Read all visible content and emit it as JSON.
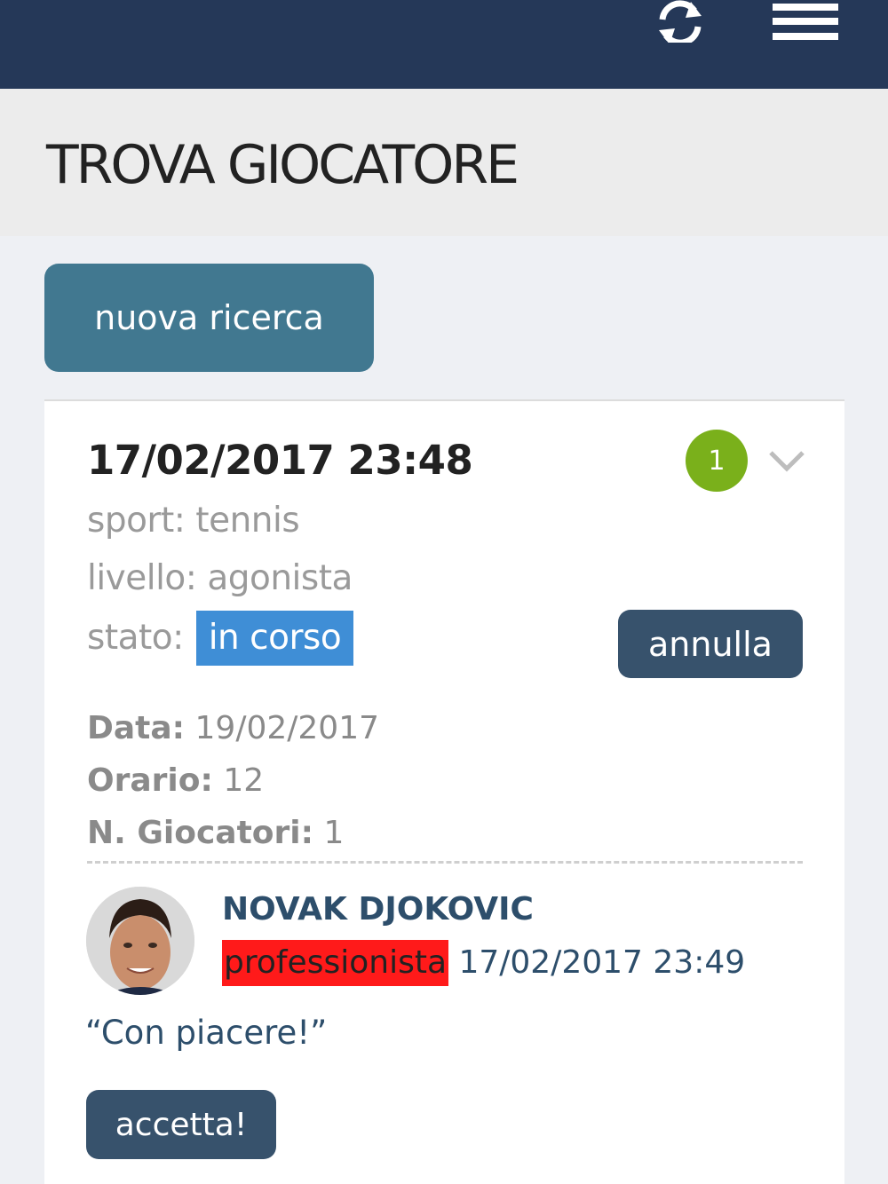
{
  "header": {
    "refresh_icon": "refresh-icon",
    "menu_icon": "hamburger-menu-icon",
    "background_color": "#253858"
  },
  "page": {
    "title": "TROVA GIOCATORE"
  },
  "actions": {
    "new_search_label": "nuova ricerca"
  },
  "search": {
    "date": "17/02/2017 23:48",
    "response_count": "1",
    "expand_icon": "chevron-down-icon",
    "sport": "sport: tennis",
    "level": "livello: agonista",
    "state_label": "stato:",
    "state_value": "in corso",
    "cancel_label": "annulla",
    "details": {
      "date_label": "Data:",
      "date_value": "19/02/2017",
      "time_label": "Orario:",
      "time_value": "12",
      "players_label": "N. Giocatori:",
      "players_value": "1"
    },
    "response": {
      "player_name": "NOVAK DJOKOVIC",
      "player_level": "professionista",
      "timestamp": "17/02/2017 23:49",
      "message": "“Con piacere!”",
      "accept_label": "accetta!"
    }
  },
  "colors": {
    "accent": "#417890",
    "button_dark": "#37526c",
    "badge_green": "#7ab01b",
    "state_blue": "#3f8ed6",
    "level_red": "#ff1a1a"
  }
}
